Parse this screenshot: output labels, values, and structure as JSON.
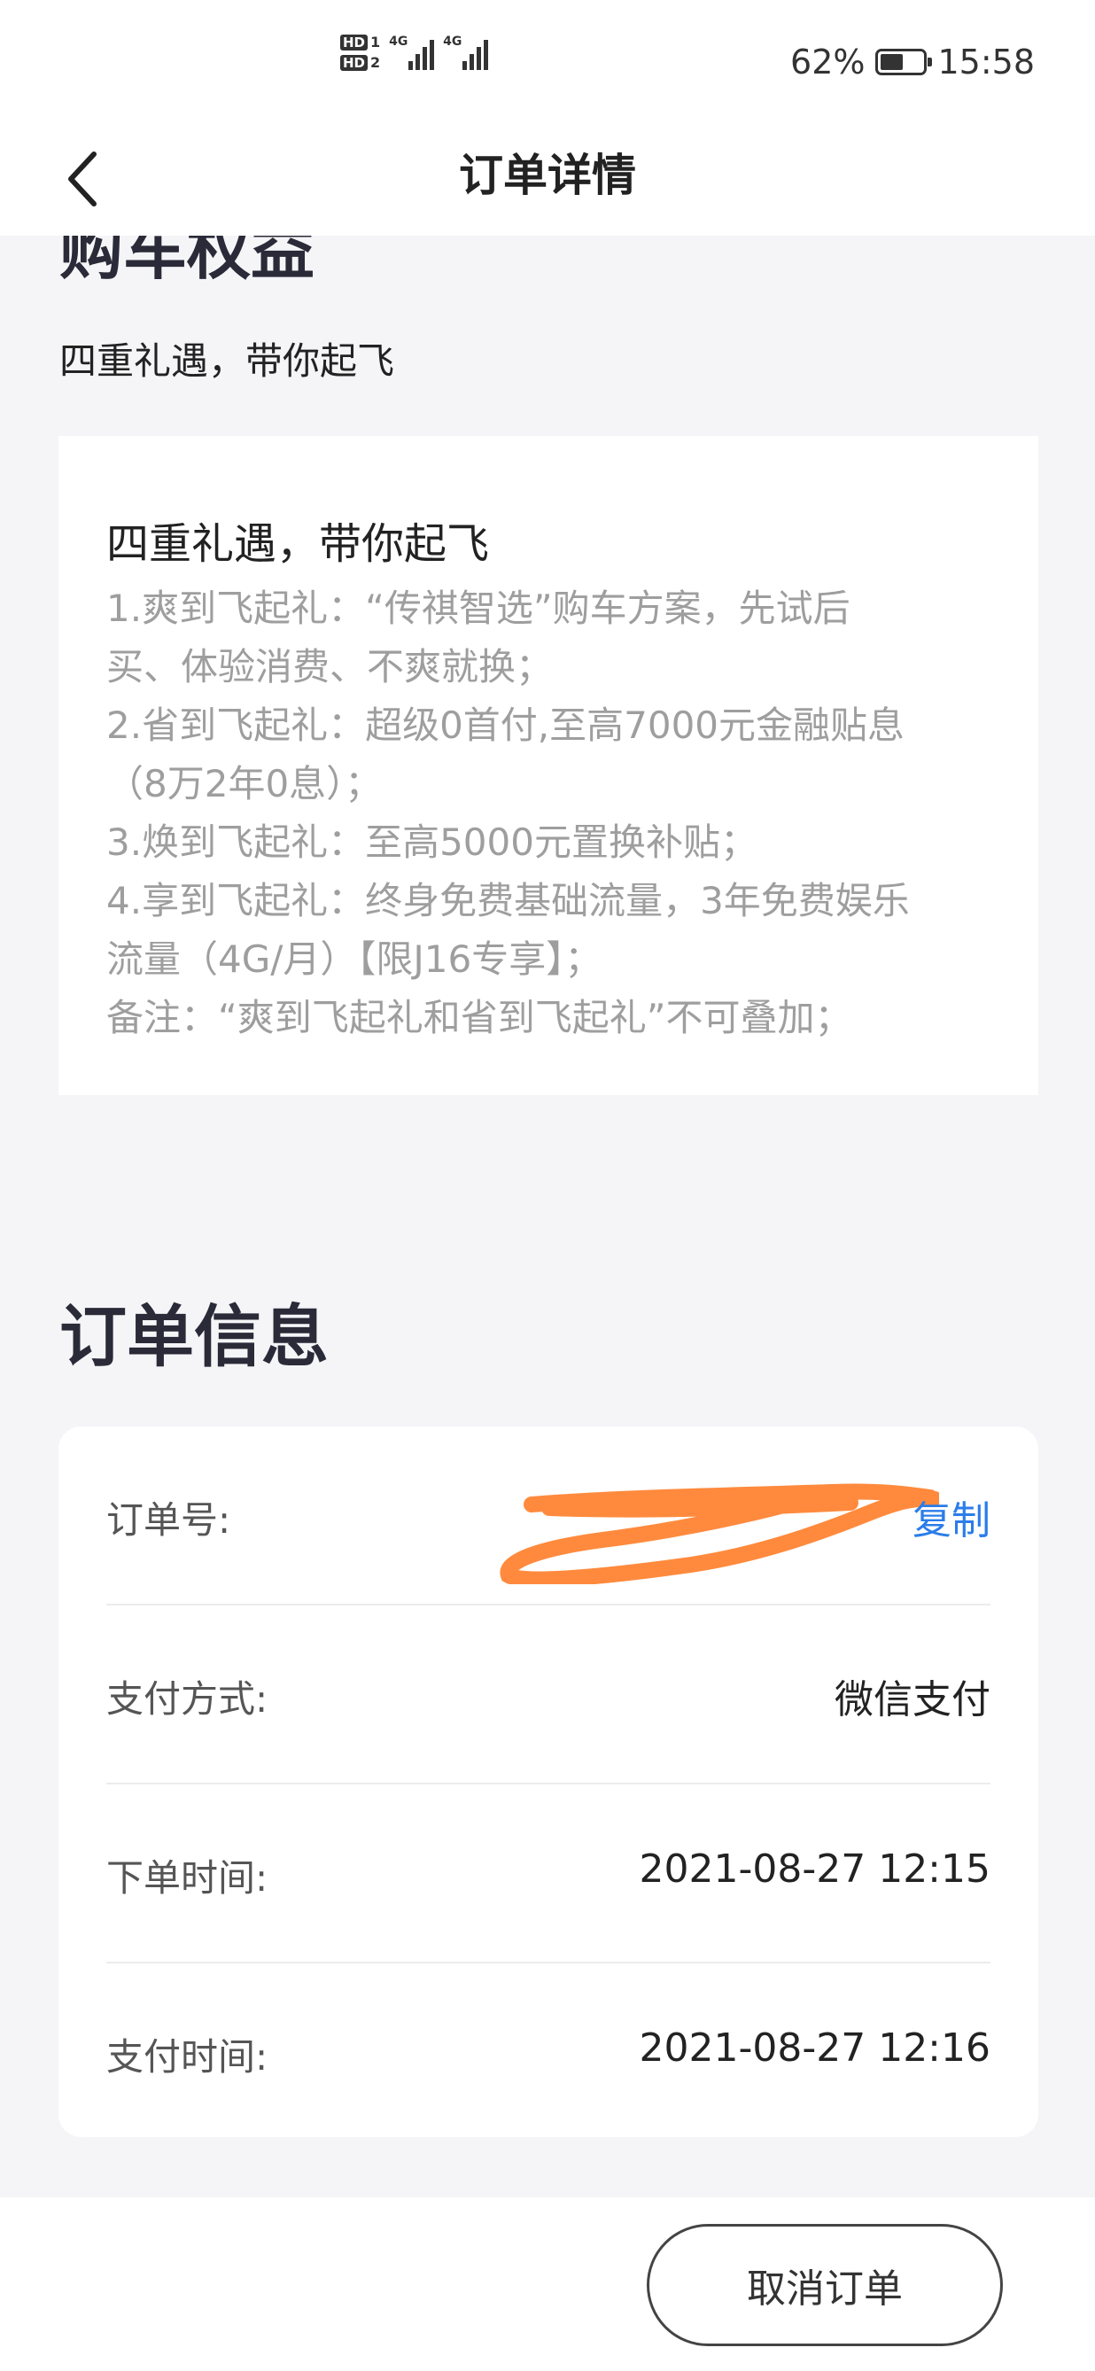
{
  "status_bar": {
    "sim1": "HD",
    "sim1_num": "1",
    "sim2": "HD",
    "sim2_num": "2",
    "network1": "4G",
    "network2": "4G",
    "battery": "62%",
    "battery_level": 0.62,
    "time": "15:58"
  },
  "nav": {
    "title": "订单详情"
  },
  "benefits": {
    "section_title": "购车权益",
    "subtitle": "四重礼遇，带你起飞",
    "card_title": "四重礼遇，带你起飞",
    "lines": [
      "1.爽到飞起礼：“传祺智选”购车方案，先试后",
      "买、体验消费、不爽就换；",
      "2.省到飞起礼：超级0首付,至高7000元金融贴息",
      "（8万2年0息）；",
      "3.焕到飞起礼：至高5000元置换补贴；",
      "4.享到飞起礼：终身免费基础流量，3年免费娱乐",
      "流量（4G/月）【限J16专享】；",
      "备注：“爽到飞起礼和省到飞起礼”不可叠加；"
    ]
  },
  "order_info": {
    "section_title": "订单信息",
    "order_no_label": "订单号:",
    "copy_label": "复制",
    "payment_method_label": "支付方式:",
    "payment_method": "微信支付",
    "order_time_label": "下单时间:",
    "order_time": "2021-08-27 12:15",
    "pay_time_label": "支付时间:",
    "pay_time": "2021-08-27 12:16",
    "redaction_color": "#ff8a3d"
  },
  "footer": {
    "cancel_label": "取消订单"
  },
  "icons": {
    "back": "chevron-left-icon"
  }
}
